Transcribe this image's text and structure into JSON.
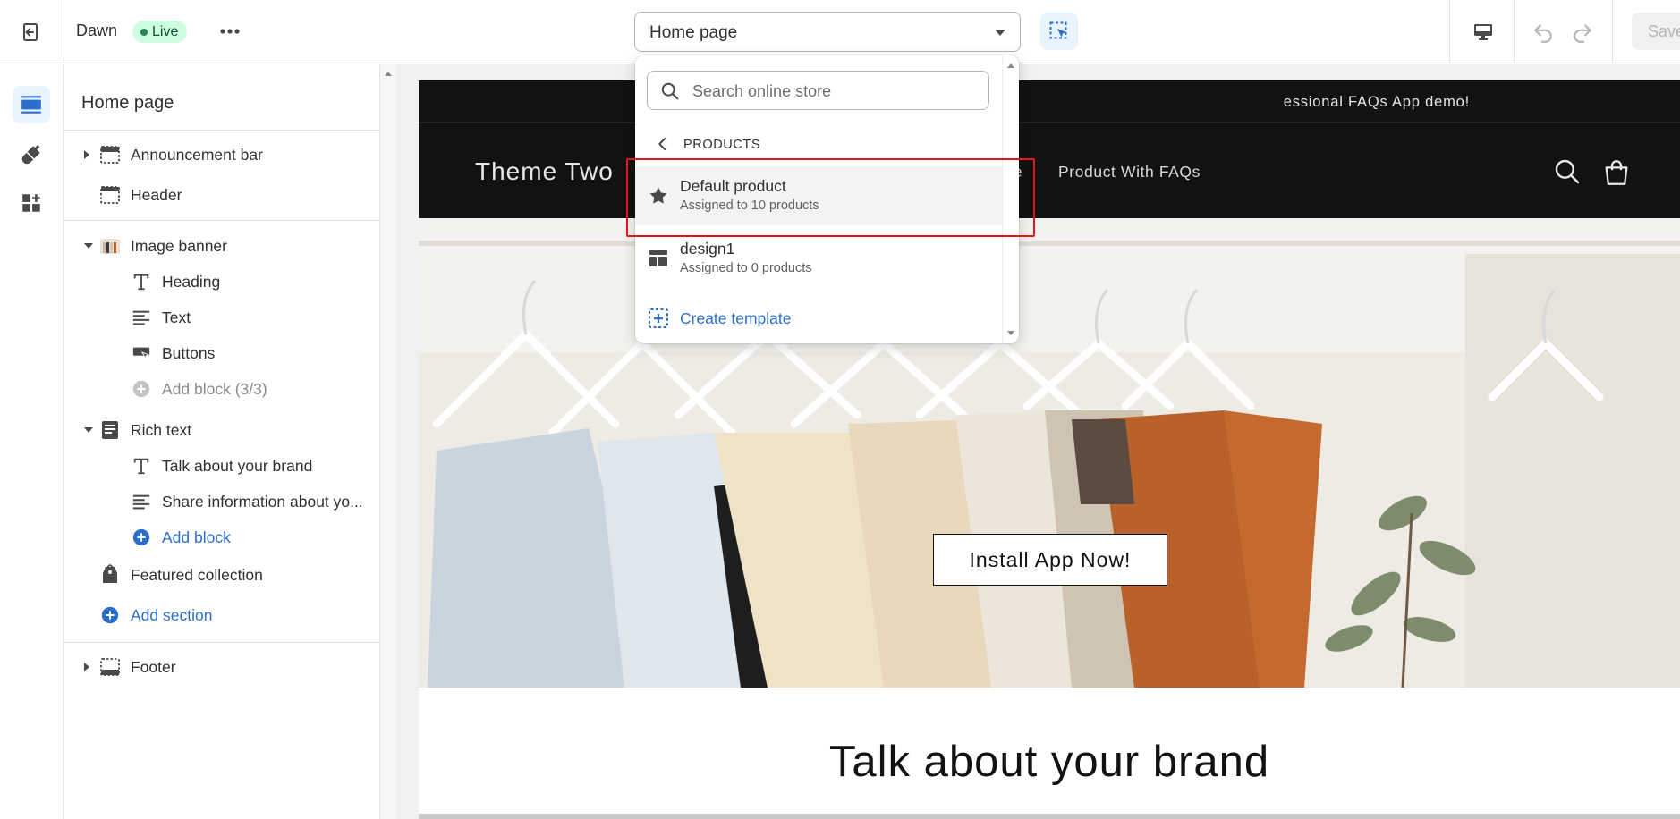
{
  "topbar": {
    "theme_name": "Dawn",
    "status_badge": "Live",
    "page_selector_value": "Home page",
    "save_label": "Save"
  },
  "sidebar": {
    "title": "Home page",
    "items": [
      {
        "label": "Announcement bar",
        "icon": "announcement-bar-icon"
      },
      {
        "label": "Header",
        "icon": "header-icon"
      },
      {
        "label": "Image banner",
        "icon": "image-thumbnail-icon"
      },
      {
        "label": "Heading",
        "icon": "text-t-icon"
      },
      {
        "label": "Text",
        "icon": "text-lines-icon"
      },
      {
        "label": "Buttons",
        "icon": "button-icon"
      },
      {
        "label": "Add block (3/3)",
        "icon": "plus-circle-icon"
      },
      {
        "label": "Rich text",
        "icon": "rich-text-icon"
      },
      {
        "label": "Talk about your brand",
        "icon": "text-t-icon"
      },
      {
        "label": "Share information about yo...",
        "icon": "text-lines-icon"
      },
      {
        "label": "Add block",
        "icon": "plus-circle-icon"
      },
      {
        "label": "Featured collection",
        "icon": "tag-icon"
      },
      {
        "label": "Add section",
        "icon": "plus-circle-icon"
      },
      {
        "label": "Footer",
        "icon": "footer-icon"
      }
    ]
  },
  "dropdown": {
    "search_placeholder": "Search online store",
    "section_title": "PRODUCTS",
    "templates": [
      {
        "name": "Default product",
        "sub": "Assigned to 10 products",
        "icon": "star-icon"
      },
      {
        "name": "design1",
        "sub": "Assigned to 0 products",
        "icon": "layout-icon"
      }
    ],
    "create_label": "Create template"
  },
  "preview": {
    "announcement_text": "essional FAQs App demo!",
    "store_logo": "Theme Two",
    "nav_fragment": "ee",
    "nav_item": "Product With FAQs",
    "banner_button": "Install App Now!",
    "rich_text_heading": "Talk about your brand"
  },
  "colors": {
    "accent": "#2c6ecb",
    "live_badge_bg": "#cdfee1",
    "highlight": "#e0171e",
    "store_header_bg": "#121212"
  }
}
